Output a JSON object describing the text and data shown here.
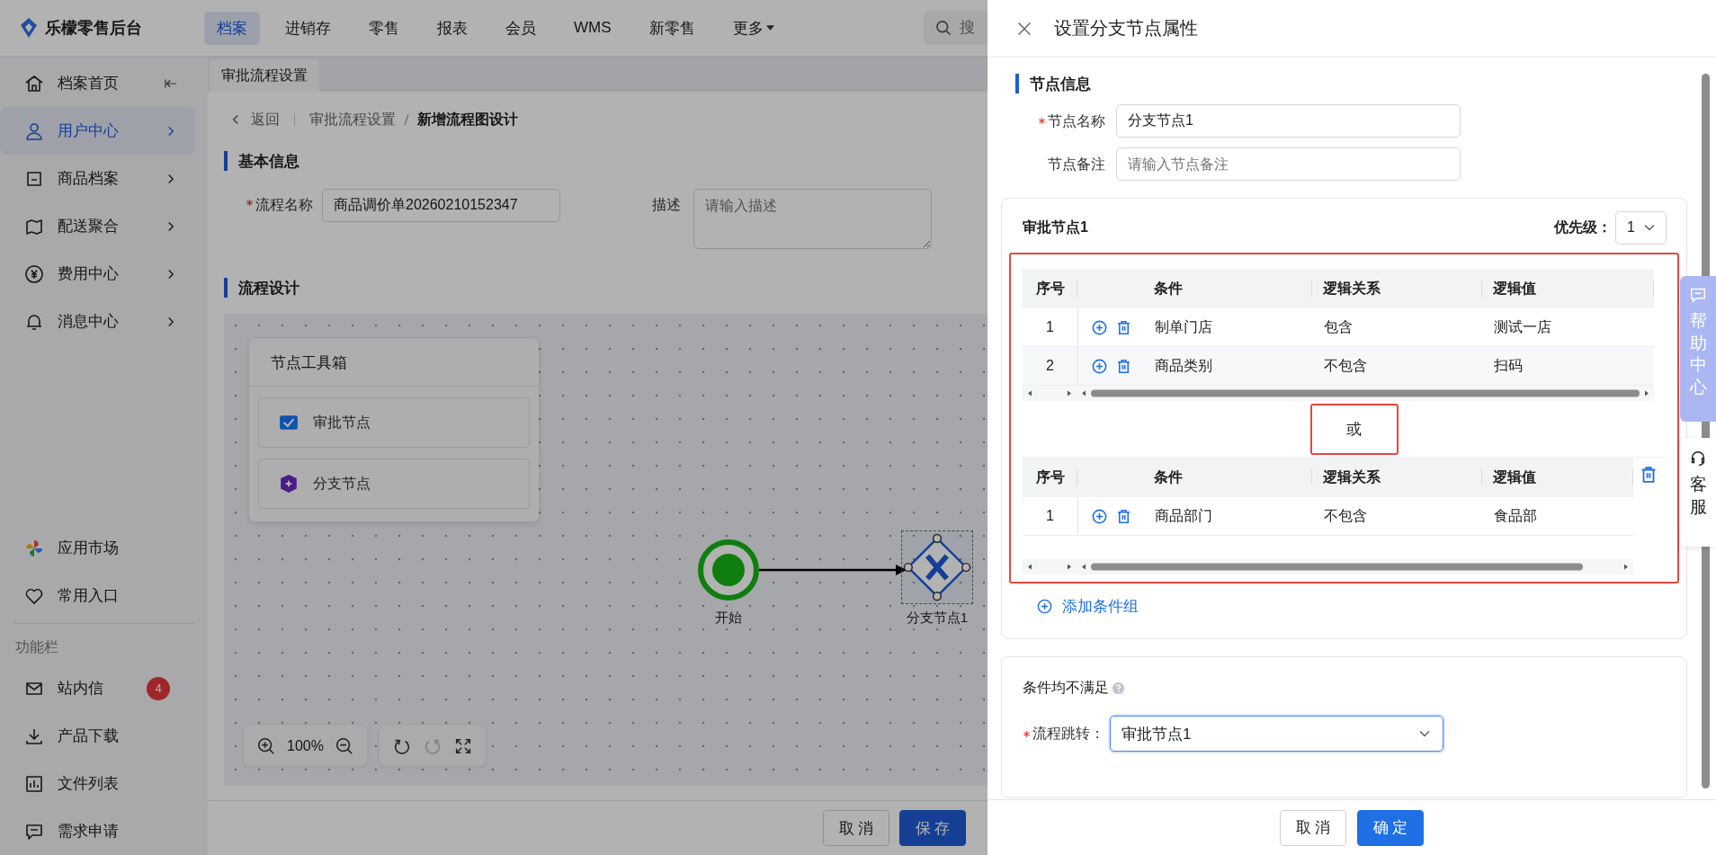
{
  "app": {
    "logo": "乐檬零售后台"
  },
  "nav": [
    {
      "label": "档案",
      "selected": true
    },
    {
      "label": "进销存",
      "selected": false
    },
    {
      "label": "零售",
      "selected": false
    },
    {
      "label": "报表",
      "selected": false
    },
    {
      "label": "会员",
      "selected": false
    },
    {
      "label": "WMS",
      "selected": false
    },
    {
      "label": "新零售",
      "selected": false
    },
    {
      "label": "更多",
      "selected": false,
      "dropdown": true
    }
  ],
  "search": {
    "placeholder": "搜"
  },
  "sidebar": {
    "items": [
      {
        "label": "档案首页",
        "selected": false
      },
      {
        "label": "用户中心",
        "selected": true
      },
      {
        "label": "商品档案",
        "selected": false
      },
      {
        "label": "配送聚合",
        "selected": false
      },
      {
        "label": "费用中心",
        "selected": false
      },
      {
        "label": "消息中心",
        "selected": false
      }
    ],
    "apps": [
      {
        "label": "应用市场"
      },
      {
        "label": "常用入口"
      }
    ],
    "section_title": "功能栏",
    "tools": [
      {
        "label": "站内信",
        "badge": "4"
      },
      {
        "label": "产品下载"
      },
      {
        "label": "文件列表"
      },
      {
        "label": "需求申请"
      }
    ]
  },
  "page_tabs": [
    {
      "label": "审批流程设置",
      "selected": true
    }
  ],
  "breadcrumb": {
    "back": "返回",
    "items": [
      "审批流程设置",
      "新增流程图设计"
    ]
  },
  "basic_info": {
    "title": "基本信息",
    "name_label": "流程名称",
    "name_required": true,
    "name_value": "商品调价单20260210152347",
    "desc_label": "描述",
    "desc_placeholder": "请输入描述"
  },
  "flow_design": {
    "title": "流程设计",
    "toolbox": {
      "title": "节点工具箱",
      "items": [
        "审批节点",
        "分支节点"
      ]
    },
    "nodes": [
      {
        "kind": "start",
        "label": "开始",
        "selected": false
      },
      {
        "kind": "branch",
        "label": "分支节点1",
        "selected": true
      }
    ],
    "zoom": "100%",
    "redo_disabled": true
  },
  "footer_buttons": [
    {
      "label": "取消",
      "primary": false
    },
    {
      "label": "保存",
      "primary": true
    }
  ],
  "drawer": {
    "title": "设置分支节点属性",
    "section": "节点信息",
    "name_label": "节点名称",
    "name_required": true,
    "name_value": "分支节点1",
    "note_label": "节点备注",
    "note_placeholder": "请输入节点备注",
    "branch": {
      "title": "审批节点1",
      "priority_label": "优先级：",
      "priority_value": "1",
      "separator": "或",
      "add_group": "添加条件组",
      "groups": [
        {
          "deletable": false,
          "columns": [
            "序号",
            "条件",
            "逻辑关系",
            "逻辑值"
          ],
          "rows": [
            {
              "index": "1",
              "condition": "制单门店",
              "relation": "包含",
              "value": "测试一店"
            },
            {
              "index": "2",
              "condition": "商品类别",
              "relation": "不包含",
              "value": "扫码"
            }
          ]
        },
        {
          "deletable": true,
          "columns": [
            "序号",
            "条件",
            "逻辑关系",
            "逻辑值"
          ],
          "rows": [
            {
              "index": "1",
              "condition": "商品部门",
              "relation": "不包含",
              "value": "食品部"
            }
          ]
        }
      ]
    },
    "fallback": {
      "title": "条件均不满足",
      "jump_label": "流程跳转：",
      "jump_required": true,
      "jump_value": "审批节点1"
    },
    "buttons": [
      {
        "label": "取消",
        "primary": false
      },
      {
        "label": "确定",
        "primary": true
      }
    ]
  },
  "help": {
    "help_label": "帮助中心",
    "service_label": "客服"
  }
}
